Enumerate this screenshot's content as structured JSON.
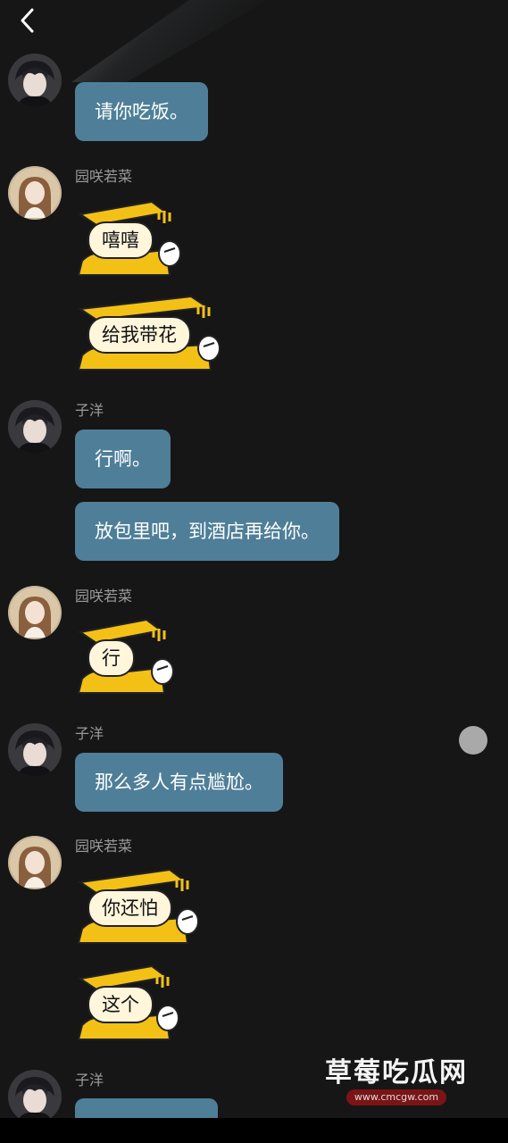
{
  "header": {
    "back_icon": "chevron-left-icon"
  },
  "colors": {
    "background": "#161616",
    "bubble": "#4f7f98",
    "sticker_yellow": "#f3c116"
  },
  "messages": [
    {
      "sender": "",
      "type": "text",
      "content": "请你吃饭。"
    },
    {
      "sender": "园咲若菜",
      "type": "sticker",
      "content": "嘻嘻"
    },
    {
      "sender": "园咲若菜",
      "type": "sticker",
      "content": "给我带花"
    },
    {
      "sender": "子洋",
      "type": "text",
      "content": "行啊。"
    },
    {
      "sender": "子洋",
      "type": "text",
      "content": "放包里吧，到酒店再给你。"
    },
    {
      "sender": "园咲若菜",
      "type": "sticker",
      "content": "行"
    },
    {
      "sender": "子洋",
      "type": "text",
      "content": "那么多人有点尴尬。"
    },
    {
      "sender": "园咲若菜",
      "type": "sticker",
      "content": "你还怕"
    },
    {
      "sender": "园咲若菜",
      "type": "sticker",
      "content": "这个"
    },
    {
      "sender": "子洋",
      "type": "text",
      "content": ""
    }
  ],
  "names": {
    "female": "园咲若菜",
    "male": "子洋"
  },
  "watermark": {
    "title": "草莓吃瓜网",
    "url": "www.cmcgw.com"
  }
}
